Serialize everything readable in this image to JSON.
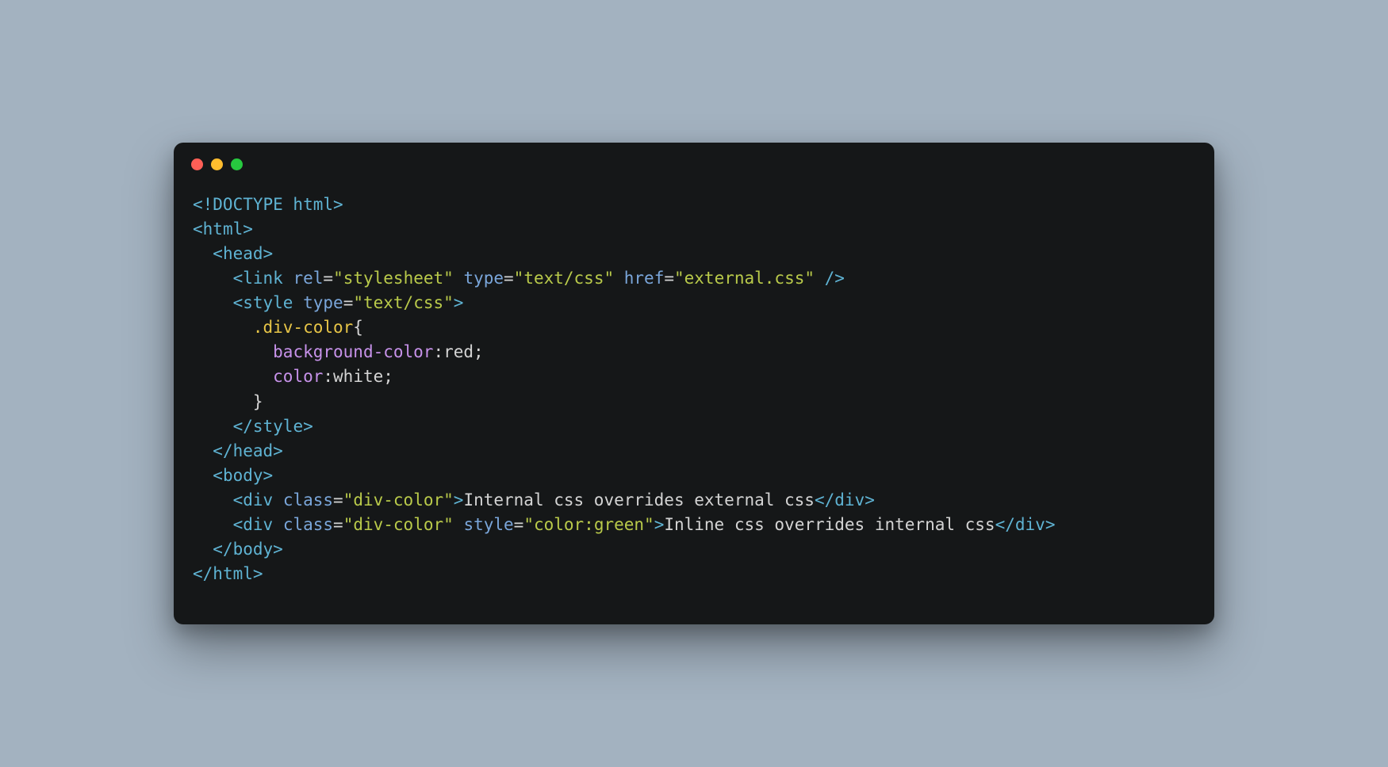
{
  "code": {
    "l1_doctype": "<!DOCTYPE html>",
    "l2_open": "<",
    "l2_tag": "html",
    "l2_close": ">",
    "l3_open": "<",
    "l3_tag": "head",
    "l3_close": ">",
    "l4_open": "<",
    "l4_tag": "link",
    "l4_sp1": " ",
    "l4_attr1": "rel",
    "l4_eq": "=",
    "l4_val1": "\"stylesheet\"",
    "l4_sp2": " ",
    "l4_attr2": "type",
    "l4_val2": "\"text/css\"",
    "l4_sp3": " ",
    "l4_attr3": "href",
    "l4_val3": "\"external.css\"",
    "l4_close": " />",
    "l5_open": "<",
    "l5_tag": "style",
    "l5_sp": " ",
    "l5_attr": "type",
    "l5_val": "\"text/css\"",
    "l5_close": ">",
    "l6_sel": ".div-color",
    "l6_brace": "{",
    "l7_prop": "background-color",
    "l7_colon": ":",
    "l7_val": "red",
    "l7_semi": ";",
    "l8_prop": "color",
    "l8_colon": ":",
    "l8_val": "white",
    "l8_semi": ";",
    "l9_brace": "}",
    "l10_open": "</",
    "l10_tag": "style",
    "l10_close": ">",
    "l11_open": "</",
    "l11_tag": "head",
    "l11_close": ">",
    "l12_open": "<",
    "l12_tag": "body",
    "l12_close": ">",
    "l13_open": "<",
    "l13_tag": "div",
    "l13_sp": " ",
    "l13_attr": "class",
    "l13_val": "\"div-color\"",
    "l13_close": ">",
    "l13_text": "Internal css overrides external css",
    "l13_copen": "</",
    "l13_ctag": "div",
    "l13_cclose": ">",
    "l14_open": "<",
    "l14_tag": "div",
    "l14_sp1": " ",
    "l14_attr1": "class",
    "l14_val1": "\"div-color\"",
    "l14_sp2": " ",
    "l14_attr2": "style",
    "l14_val2": "\"color:green\"",
    "l14_close": ">",
    "l14_text": "Inline css overrides internal css",
    "l14_copen": "</",
    "l14_ctag": "div",
    "l14_cclose": ">",
    "l15_open": "</",
    "l15_tag": "body",
    "l15_close": ">",
    "l16_open": "</",
    "l16_tag": "html",
    "l16_close": ">"
  }
}
